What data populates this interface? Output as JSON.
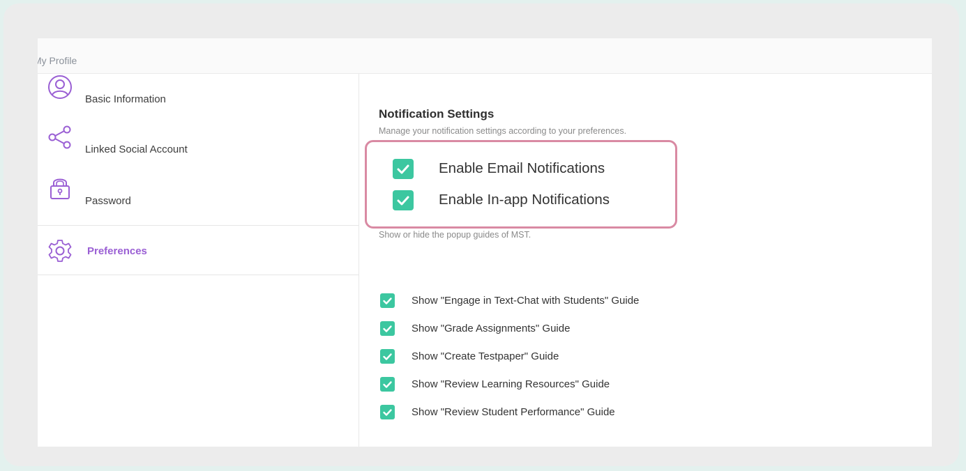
{
  "header": {
    "title": "My Profile"
  },
  "sidebar": {
    "items": [
      {
        "label": "Basic Information",
        "icon": "user-circle-icon",
        "active": false
      },
      {
        "label": "Linked Social Account",
        "icon": "share-icon",
        "active": false
      },
      {
        "label": "Password",
        "icon": "lock-icon",
        "active": false
      },
      {
        "label": "Preferences",
        "icon": "gear-icon",
        "active": true
      }
    ]
  },
  "notifications": {
    "title": "Notification Settings",
    "subtitle": "Manage your notification settings according to your preferences.",
    "options": [
      {
        "label": "Enable Email Notifications",
        "checked": true
      },
      {
        "label": "Enable In-app Notifications",
        "checked": true
      }
    ]
  },
  "guides": {
    "subtitle": "Show or hide the popup guides of MST.",
    "options": [
      {
        "label": "Show \"Engage in Text-Chat with Students\" Guide",
        "checked": true
      },
      {
        "label": "Show \"Grade Assignments\" Guide",
        "checked": true
      },
      {
        "label": "Show \"Create Testpaper\" Guide",
        "checked": true
      },
      {
        "label": "Show \"Review Learning Resources\" Guide",
        "checked": true
      },
      {
        "label": "Show \"Review Student Performance\" Guide",
        "checked": true
      }
    ]
  },
  "colors": {
    "accent_purple": "#9a5fd4",
    "check_green": "#3cc7a0",
    "highlight_pink": "#d98aa3",
    "background_mint": "#e3f1ee"
  }
}
